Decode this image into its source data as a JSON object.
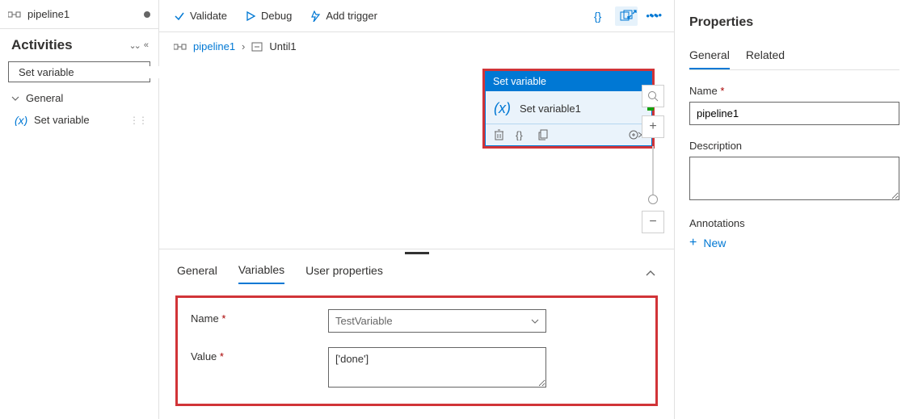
{
  "tab": {
    "title": "pipeline1"
  },
  "activities": {
    "title": "Activities",
    "search_value": "Set variable",
    "group": "General",
    "leaf": "Set variable"
  },
  "toolbar": {
    "validate": "Validate",
    "debug": "Debug",
    "add_trigger": "Add trigger"
  },
  "breadcrumb": {
    "root": "pipeline1",
    "child": "Until1"
  },
  "node": {
    "type": "Set variable",
    "name": "Set variable1"
  },
  "bottom_tabs": {
    "general": "General",
    "variables": "Variables",
    "user_props": "User properties"
  },
  "form": {
    "name_label": "Name",
    "name_value": "TestVariable",
    "value_label": "Value",
    "value_value": "['done']"
  },
  "props": {
    "title": "Properties",
    "tab_general": "General",
    "tab_related": "Related",
    "name_label": "Name",
    "name_value": "pipeline1",
    "desc_label": "Description",
    "ann_label": "Annotations",
    "new": "New"
  }
}
